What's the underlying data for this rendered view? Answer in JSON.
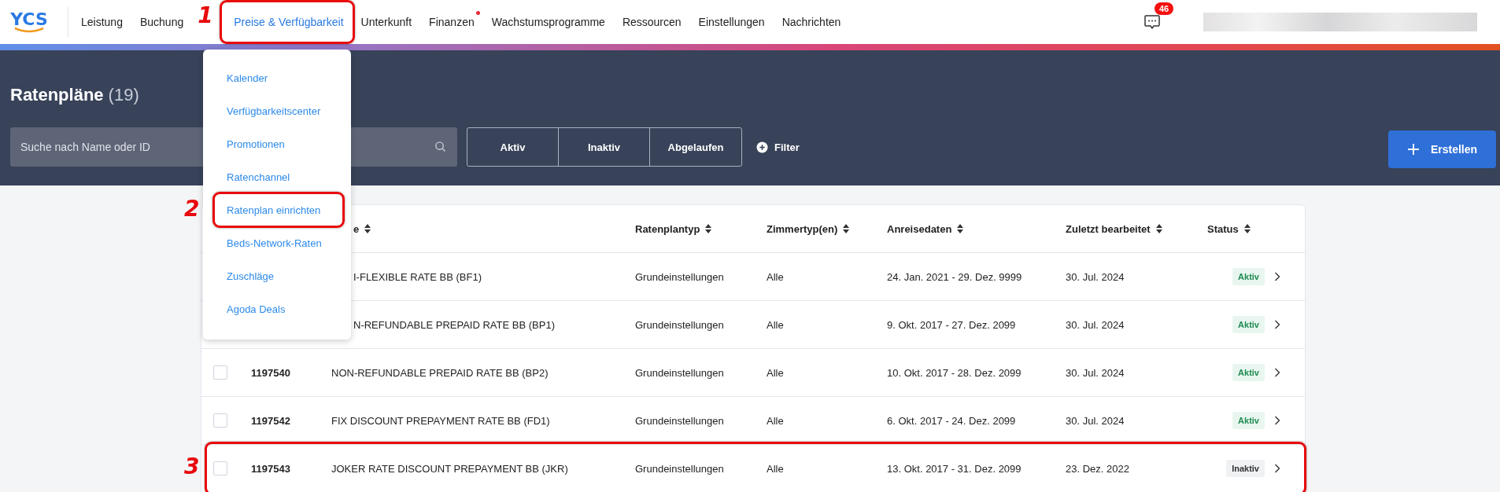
{
  "nav": {
    "logo": "YCS",
    "items": [
      {
        "label": "Leistung",
        "selected": false,
        "dot": false
      },
      {
        "label": "Buchung",
        "selected": false,
        "dot": false
      },
      {
        "label": "Preise & Verfügbarkeit",
        "selected": true,
        "dot": false,
        "annotation": "1"
      },
      {
        "label": "Unterkunft",
        "selected": false,
        "dot": false
      },
      {
        "label": "Finanzen",
        "selected": false,
        "dot": true
      },
      {
        "label": "Wachstumsprogramme",
        "selected": false,
        "dot": false
      },
      {
        "label": "Ressourcen",
        "selected": false,
        "dot": false
      },
      {
        "label": "Einstellungen",
        "selected": false,
        "dot": false
      },
      {
        "label": "Nachrichten",
        "selected": false,
        "dot": false
      }
    ],
    "messages_badge": "46"
  },
  "dropdown": {
    "items": [
      {
        "label": "Kalender"
      },
      {
        "label": "Verfügbarkeitscenter"
      },
      {
        "label": "Promotionen"
      },
      {
        "label": "Ratenchannel"
      },
      {
        "label": "Ratenplan einrichten",
        "annotation": "2"
      },
      {
        "label": "Beds-Network-Raten"
      },
      {
        "label": "Zuschläge"
      },
      {
        "label": "Agoda Deals"
      }
    ]
  },
  "page": {
    "title": "Ratenpläne",
    "count": "(19)"
  },
  "search": {
    "placeholder": "Suche nach Name oder ID"
  },
  "status_filters": [
    {
      "label": "Aktiv",
      "selected": false
    },
    {
      "label": "Inaktiv",
      "selected": false
    },
    {
      "label": "Abgelaufen",
      "selected": false
    }
  ],
  "filter_button": "Filter",
  "create_button": "Erstellen",
  "table": {
    "columns": [
      "e",
      "Ratenplantyp",
      "Zimmertyp(en)",
      "Anreisedaten",
      "Zuletzt bearbeitet",
      "Status"
    ],
    "rows": [
      {
        "name": "I-FLEXIBLE RATE BB (BF1)",
        "type": "Grundeinstellungen",
        "rooms": "Alle",
        "dates": "24. Jan. 2021 - 29. Dez. 9999",
        "edited": "30. Jul. 2024",
        "status": {
          "label": "Aktiv",
          "kind": "active"
        }
      },
      {
        "name": "N-REFUNDABLE PREPAID RATE BB (BP1)",
        "type": "Grundeinstellungen",
        "rooms": "Alle",
        "dates": "9. Okt. 2017 - 27. Dez. 2099",
        "edited": "30. Jul. 2024",
        "status": {
          "label": "Aktiv",
          "kind": "active"
        }
      },
      {
        "checked": false,
        "id": "1197540",
        "name": "NON-REFUNDABLE PREPAID RATE BB (BP2)",
        "type": "Grundeinstellungen",
        "rooms": "Alle",
        "dates": "10. Okt. 2017 - 28. Dez. 2099",
        "edited": "30. Jul. 2024",
        "status": {
          "label": "Aktiv",
          "kind": "active"
        }
      },
      {
        "checked": false,
        "id": "1197542",
        "name": "FIX DISCOUNT PREPAYMENT RATE BB (FD1)",
        "type": "Grundeinstellungen",
        "rooms": "Alle",
        "dates": "6. Okt. 2017 - 24. Dez. 2099",
        "edited": "30. Jul. 2024",
        "status": {
          "label": "Aktiv",
          "kind": "active"
        }
      },
      {
        "checked": false,
        "id": "1197543",
        "name": "JOKER RATE DISCOUNT PREPAYMENT BB (JKR)",
        "type": "Grundeinstellungen",
        "rooms": "Alle",
        "dates": "13. Okt. 2017 - 31. Dez. 2099",
        "edited": "23. Dez. 2022",
        "status": {
          "label": "Inaktiv",
          "kind": "inactive"
        },
        "annotation": "3"
      }
    ]
  }
}
